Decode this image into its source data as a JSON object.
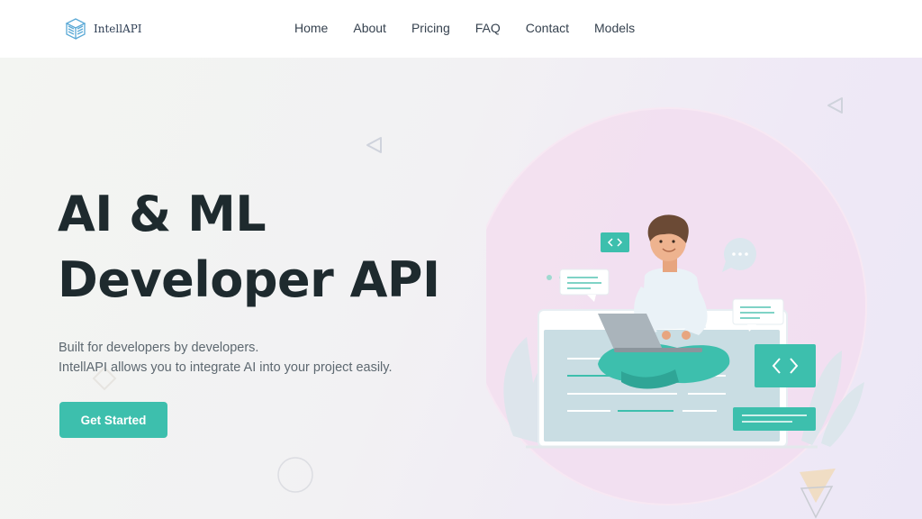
{
  "brand": {
    "name": "IntellAPI",
    "logo_icon": "cube-lines-logo"
  },
  "nav": {
    "items": [
      {
        "label": "Home"
      },
      {
        "label": "About"
      },
      {
        "label": "Pricing"
      },
      {
        "label": "FAQ"
      },
      {
        "label": "Contact"
      },
      {
        "label": "Models"
      }
    ]
  },
  "hero": {
    "title_line1": "AI & ML",
    "title_line2": "Developer API",
    "subtitle_line1": "Built for developers by developers.",
    "subtitle_line2": "IntellAPI allows you to integrate AI into your project easily.",
    "cta_label": "Get Started"
  },
  "colors": {
    "accent": "#3dbfad",
    "heading": "#1e2a2e",
    "text": "#5d6870",
    "blob": "#f0d4ec"
  }
}
